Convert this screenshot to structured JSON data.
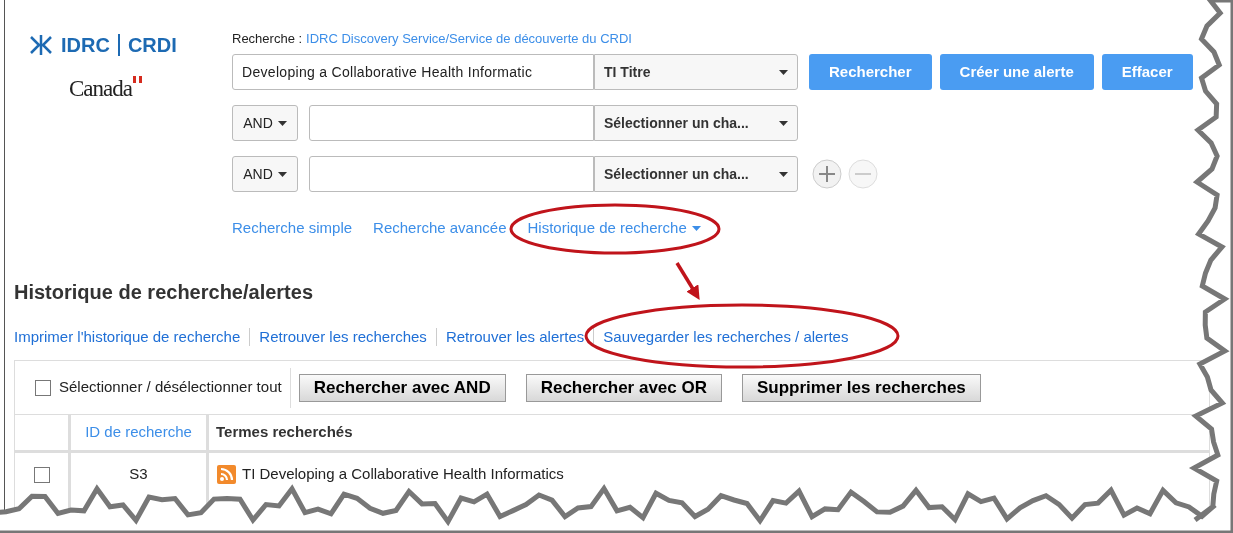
{
  "logo": {
    "left": "IDRC",
    "right": "CRDI",
    "wordmark": "Canada"
  },
  "search": {
    "label": "Recherche :",
    "source": "IDRC Discovery Service/Service de découverte du CRDI",
    "rows": [
      {
        "value": "Developing a Collaborative Health Informatic",
        "field": "TI Titre"
      },
      {
        "operator": "AND",
        "field": "Sélectionner un cha..."
      },
      {
        "operator": "AND",
        "field": "Sélectionner un cha..."
      }
    ],
    "buttons": [
      "Rechercher",
      "Créer une alerte",
      "Effacer"
    ],
    "links": [
      {
        "label": "Recherche simple",
        "dropdown": false
      },
      {
        "label": "Recherche avancée",
        "dropdown": false
      },
      {
        "label": "Historique de recherche",
        "dropdown": true
      }
    ]
  },
  "history": {
    "title": "Historique de recherche/alertes",
    "links": [
      "Imprimer l'historique de recherche",
      "Retrouver les recherches",
      "Retrouver les alertes",
      "Sauvegarder les recherches / alertes"
    ],
    "select_all": {
      "label": "Sélectionner / désélectionner tout",
      "checked": false
    },
    "buttons": [
      "Rechercher avec AND",
      "Rechercher avec OR",
      "Supprimer les recherches"
    ],
    "columns": [
      "ID de recherche",
      "Termes recherchés"
    ],
    "rows": [
      {
        "checked": false,
        "id": "S3",
        "terms": "TI Developing a Collaborative Health Informatics"
      }
    ]
  }
}
